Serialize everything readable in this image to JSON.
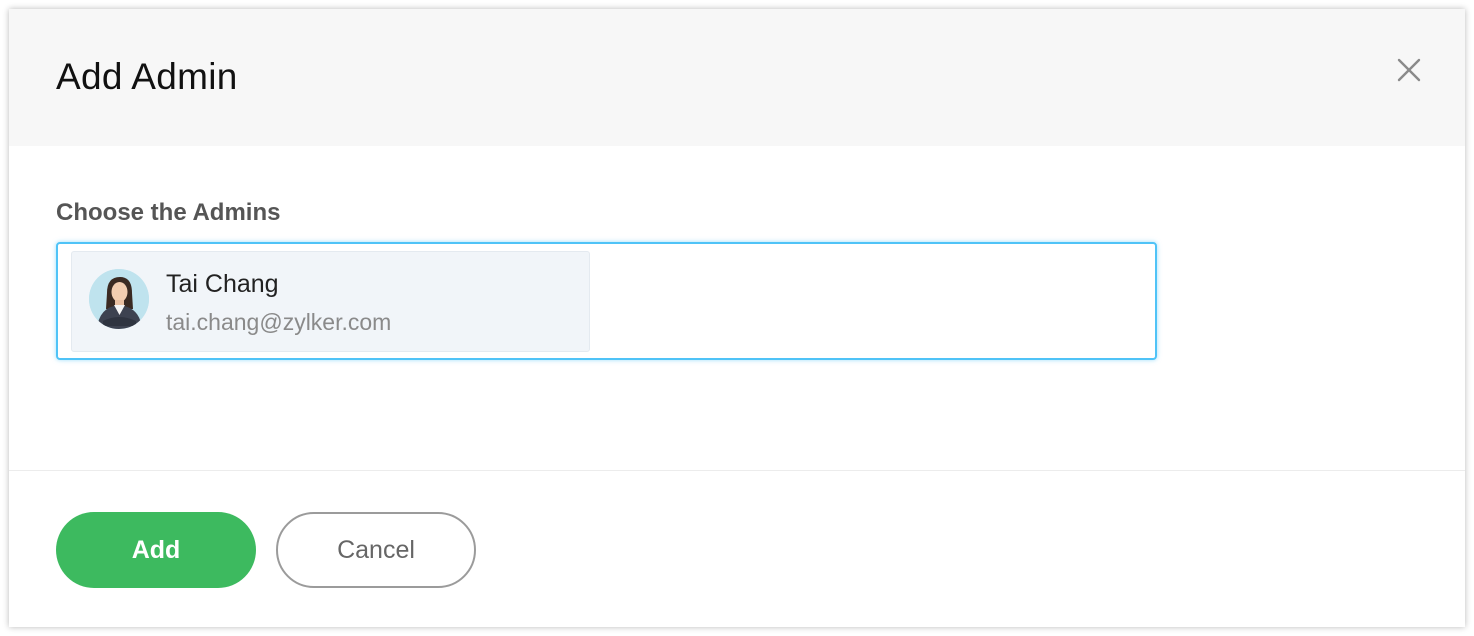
{
  "dialog": {
    "title": "Add Admin",
    "close_icon": "close-icon"
  },
  "form": {
    "label": "Choose the Admins",
    "selected": [
      {
        "name": "Tai Chang",
        "email": "tai.chang@zylker.com",
        "avatar_icon": "user-avatar"
      }
    ],
    "focus_color": "#4fc3f7"
  },
  "footer": {
    "add_label": "Add",
    "cancel_label": "Cancel",
    "add_color": "#3dba5f"
  }
}
